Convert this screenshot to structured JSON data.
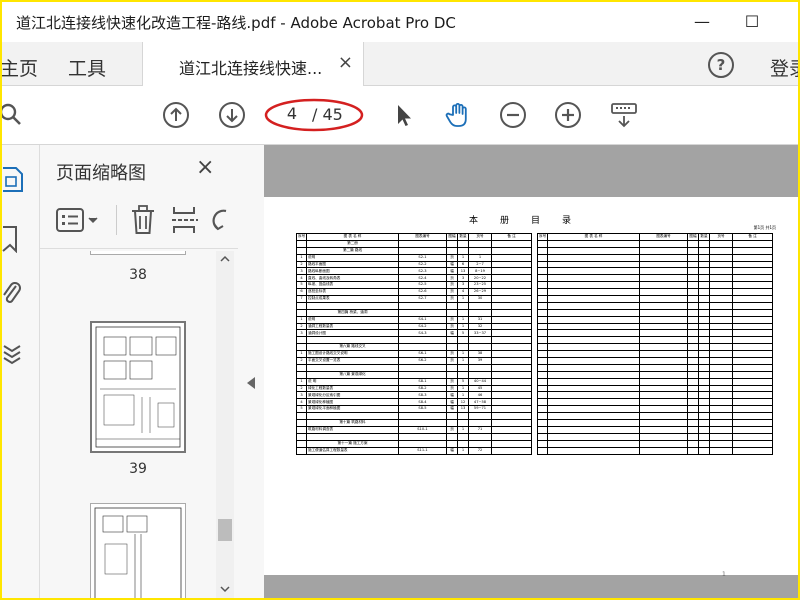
{
  "window": {
    "title": "道江北连接线快速化改造工程-路线.pdf - Adobe Acrobat Pro DC",
    "minimize_glyph": "—",
    "maximize_glyph": "☐"
  },
  "tabs": {
    "home": "主页",
    "tools": "工具",
    "document": "道江北连接线快速...",
    "close_glyph": "×",
    "help_glyph": "?",
    "sign_in": "登录"
  },
  "toolbar": {
    "current_page": "4",
    "total_pages": "/ 45"
  },
  "thumb_panel": {
    "title": "页面缩略图",
    "close_glyph": "×",
    "pages": [
      "38",
      "39"
    ]
  },
  "document": {
    "toc_title": "本册目录",
    "toc_subtitle": "第1页 共1页",
    "headers": [
      "序号",
      "图 表 名 称",
      "图表编号",
      "图幅",
      "数量",
      "页号",
      "备 注"
    ],
    "rows": [
      {
        "no": "",
        "name": "第二册",
        "code": "",
        "fmt": "",
        "qty": "",
        "page": "",
        "sect": true
      },
      {
        "no": "",
        "name": "第二篇 路线",
        "code": "",
        "fmt": "",
        "qty": "",
        "page": "",
        "sect": true
      },
      {
        "no": "1",
        "name": "说明",
        "code": "S2-1",
        "fmt": "页",
        "qty": "1",
        "page": "1"
      },
      {
        "no": "2",
        "name": "路线平面图",
        "code": "S2-2",
        "fmt": "幅",
        "qty": "6",
        "page": "2~7"
      },
      {
        "no": "3",
        "name": "路线纵断面图",
        "code": "S2-3",
        "fmt": "幅",
        "qty": "13",
        "page": "8~19"
      },
      {
        "no": "4",
        "name": "直线、曲线及转角表",
        "code": "S2-4",
        "fmt": "页",
        "qty": "3",
        "page": "20~22"
      },
      {
        "no": "5",
        "name": "纵坡、竖曲线表",
        "code": "S2-5",
        "fmt": "页",
        "qty": "3",
        "page": "23~25"
      },
      {
        "no": "6",
        "name": "逐桩坐标表",
        "code": "S2-6",
        "fmt": "页",
        "qty": "4",
        "page": "26~29"
      },
      {
        "no": "7",
        "name": "控制点成果表",
        "code": "S2-7",
        "fmt": "页",
        "qty": "1",
        "page": "30"
      },
      {
        "no": "",
        "name": "",
        "code": "",
        "fmt": "",
        "qty": "",
        "page": ""
      },
      {
        "no": "",
        "name": "第四篇 桥梁、涵洞",
        "code": "",
        "fmt": "",
        "qty": "",
        "page": "",
        "sect": true
      },
      {
        "no": "1",
        "name": "说明",
        "code": "S4-1",
        "fmt": "页",
        "qty": "1",
        "page": "31"
      },
      {
        "no": "2",
        "name": "涵洞工程数量表",
        "code": "S4-2",
        "fmt": "页",
        "qty": "1",
        "page": "32"
      },
      {
        "no": "3",
        "name": "涵洞设计图",
        "code": "S4-3",
        "fmt": "幅",
        "qty": "5",
        "page": "33~37"
      },
      {
        "no": "",
        "name": "",
        "code": "",
        "fmt": "",
        "qty": "",
        "page": ""
      },
      {
        "no": "",
        "name": "第六篇 路线交叉",
        "code": "",
        "fmt": "",
        "qty": "",
        "page": "",
        "sect": true
      },
      {
        "no": "1",
        "name": "施工图设计路线交叉说明",
        "code": "S6-1",
        "fmt": "页",
        "qty": "1",
        "page": "38"
      },
      {
        "no": "2",
        "name": "平面交叉设置一览表",
        "code": "S6-2",
        "fmt": "页",
        "qty": "1",
        "page": "39"
      },
      {
        "no": "",
        "name": "",
        "code": "",
        "fmt": "",
        "qty": "",
        "page": ""
      },
      {
        "no": "",
        "name": "第八篇 景观绿化",
        "code": "",
        "fmt": "",
        "qty": "",
        "page": "",
        "sect": true
      },
      {
        "no": "1",
        "name": "说 明",
        "code": "S8-1",
        "fmt": "页",
        "qty": "5",
        "page": "40~44"
      },
      {
        "no": "2",
        "name": "绿化工程数量表",
        "code": "S8-2",
        "fmt": "页",
        "qty": "1",
        "page": "45"
      },
      {
        "no": "3",
        "name": "景观绿化分区索引图",
        "code": "S8-3",
        "fmt": "幅",
        "qty": "1",
        "page": "46"
      },
      {
        "no": "4",
        "name": "景观绿化种植图",
        "code": "S8-4",
        "fmt": "幅",
        "qty": "12",
        "page": "47~58"
      },
      {
        "no": "5",
        "name": "景观绿化平面种植图",
        "code": "S8-5",
        "fmt": "幅",
        "qty": "13",
        "page": "59~71"
      },
      {
        "no": "",
        "name": "",
        "code": "",
        "fmt": "",
        "qty": "",
        "page": ""
      },
      {
        "no": "",
        "name": "第十篇 筑路材料",
        "code": "",
        "fmt": "",
        "qty": "",
        "page": "",
        "sect": true
      },
      {
        "no": "",
        "name": "筑路材料调查表",
        "code": "S10-1",
        "fmt": "页",
        "qty": "1",
        "page": "71"
      },
      {
        "no": "",
        "name": "",
        "code": "",
        "fmt": "",
        "qty": "",
        "page": ""
      },
      {
        "no": "",
        "name": "第十一篇 施工方案",
        "code": "",
        "fmt": "",
        "qty": "",
        "page": "",
        "sect": true
      },
      {
        "no": "",
        "name": "施工便道估算工程数量表",
        "code": "S11-1",
        "fmt": "幅",
        "qty": "1",
        "page": "72"
      }
    ],
    "page_number": "1"
  }
}
